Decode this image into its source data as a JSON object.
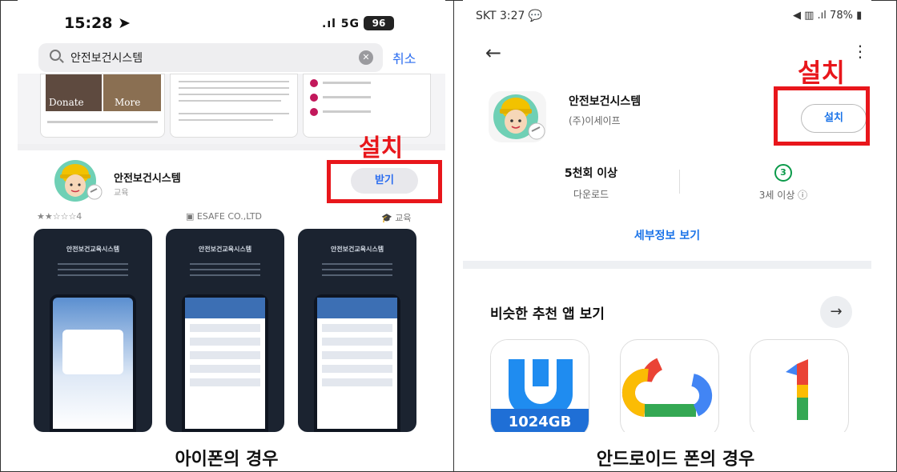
{
  "ios": {
    "time": "15:28 ➤",
    "signal": ".ıl 5G",
    "battery": "96",
    "search_query": "안전보건시스템",
    "cancel_label": "취소",
    "prev_shots": {
      "photo_label_1": "Donate",
      "photo_label_2": "More"
    },
    "app": {
      "name": "안전보건시스템",
      "category": "교육",
      "get_label": "받기"
    },
    "meta": {
      "rating": "★★☆☆☆4",
      "developer": "ESAFE CO.,LTD",
      "category": "교육"
    },
    "screenshot_title": "안전보건교육시스템",
    "install_callout": "설치"
  },
  "android": {
    "status_left": "SKT 3:27",
    "status_right": "78%",
    "app": {
      "name": "안전보건시스템",
      "developer": "(주)이세이프",
      "install_label": "설치"
    },
    "stats": {
      "downloads_value": "5천회 이상",
      "downloads_label": "다운로드",
      "age_badge": "3",
      "age_label": "3세 이상 ⓘ"
    },
    "details_link": "세부정보 보기",
    "similar_title": "비슷한 추천 앱 보기",
    "tile1_label": "1024GB",
    "install_callout": "설치"
  },
  "captions": {
    "left": "아이폰의 경우",
    "right": "안드로이드 폰의 경우"
  },
  "colors": {
    "callout_red": "#e8161b",
    "ios_blue": "#2a6cf0",
    "android_blue": "#1a73e8"
  }
}
